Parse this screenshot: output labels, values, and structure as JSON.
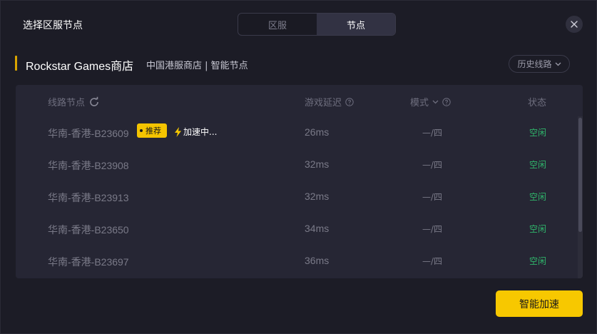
{
  "header": {
    "title": "选择区服节点",
    "tabs": [
      {
        "label": "区服",
        "active": false
      },
      {
        "label": "节点",
        "active": true
      }
    ]
  },
  "store": {
    "name": "Rockstar Games商店",
    "sub": "中国港服商店 | 智能节点",
    "history_label": "历史线路"
  },
  "table": {
    "columns": {
      "node": "线路节点",
      "latency": "游戏延迟",
      "mode": "模式",
      "status": "状态"
    },
    "rows": [
      {
        "node": "华南-香港-B23609",
        "latency": "26ms",
        "mode": "—/四",
        "status": "空闲",
        "tag": "推荐",
        "accel": "加速中..."
      },
      {
        "node": "华南-香港-B23908",
        "latency": "32ms",
        "mode": "—/四",
        "status": "空闲"
      },
      {
        "node": "华南-香港-B23913",
        "latency": "32ms",
        "mode": "—/四",
        "status": "空闲"
      },
      {
        "node": "华南-香港-B23650",
        "latency": "34ms",
        "mode": "—/四",
        "status": "空闲"
      },
      {
        "node": "华南-香港-B23697",
        "latency": "36ms",
        "mode": "—/四",
        "status": "空闲"
      }
    ]
  },
  "footer": {
    "primary_label": "智能加速"
  },
  "colors": {
    "accent": "#f7c800",
    "status_idle": "#2fb56b",
    "background": "#1c1c26"
  },
  "icons": [
    "close-icon",
    "refresh-icon",
    "help-icon",
    "chevron-down-icon",
    "lightning-icon"
  ]
}
